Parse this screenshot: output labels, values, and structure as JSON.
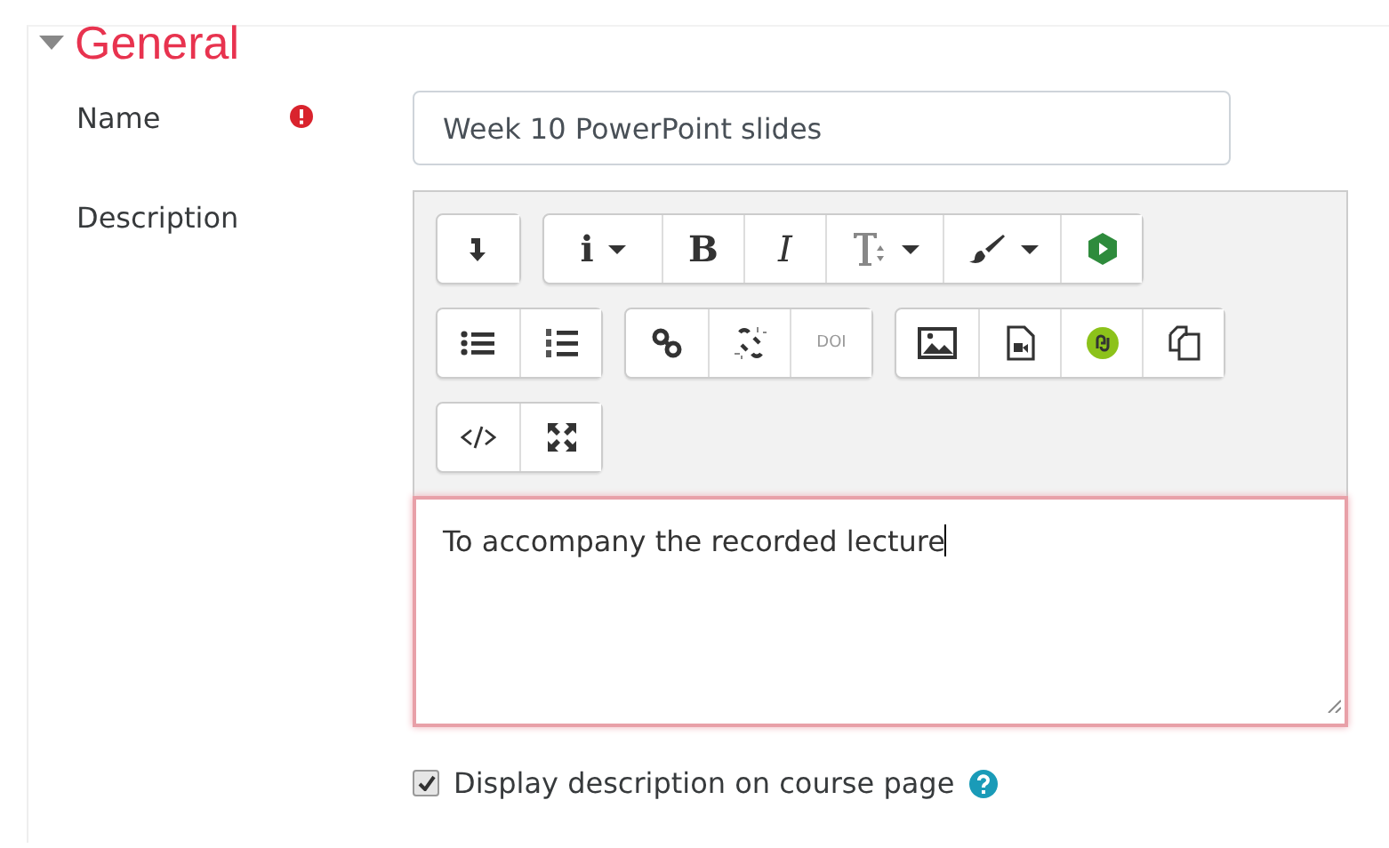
{
  "section": {
    "title": "General",
    "expanded": true
  },
  "fields": [
    {
      "kind": "text",
      "label": "Name",
      "required": true,
      "value": "Week 10 PowerPoint slides"
    },
    {
      "kind": "editor",
      "label": "Description",
      "value": "To accompany the recorded lecture",
      "focused": true,
      "toolbar": [
        [
          [
            {
              "kind": "icon",
              "dropdown": false
            }
          ],
          [
            {
              "kind": "glyph",
              "label": "i",
              "dropdown": true
            },
            {
              "kind": "glyph",
              "label": "B",
              "dropdown": false
            },
            {
              "kind": "glyph",
              "label": "I",
              "dropdown": false
            },
            {
              "kind": "icon",
              "dropdown": true
            },
            {
              "kind": "icon",
              "dropdown": true
            },
            {
              "kind": "icon",
              "dropdown": false
            }
          ]
        ],
        [
          [
            {
              "kind": "icon",
              "dropdown": false
            },
            {
              "kind": "icon",
              "dropdown": false
            }
          ],
          [
            {
              "kind": "icon",
              "dropdown": false
            },
            {
              "kind": "icon",
              "dropdown": false
            },
            {
              "kind": "glyph",
              "label": "DOI",
              "dropdown": false
            }
          ],
          [
            {
              "kind": "icon",
              "dropdown": false
            },
            {
              "kind": "icon",
              "dropdown": false
            },
            {
              "kind": "icon",
              "dropdown": false
            },
            {
              "kind": "icon",
              "dropdown": false
            }
          ]
        ],
        [
          [
            {
              "kind": "icon",
              "dropdown": false
            },
            {
              "kind": "icon",
              "dropdown": false
            }
          ]
        ]
      ]
    }
  ],
  "option": {
    "label": "Display description on course page",
    "checked": true,
    "help": true
  }
}
